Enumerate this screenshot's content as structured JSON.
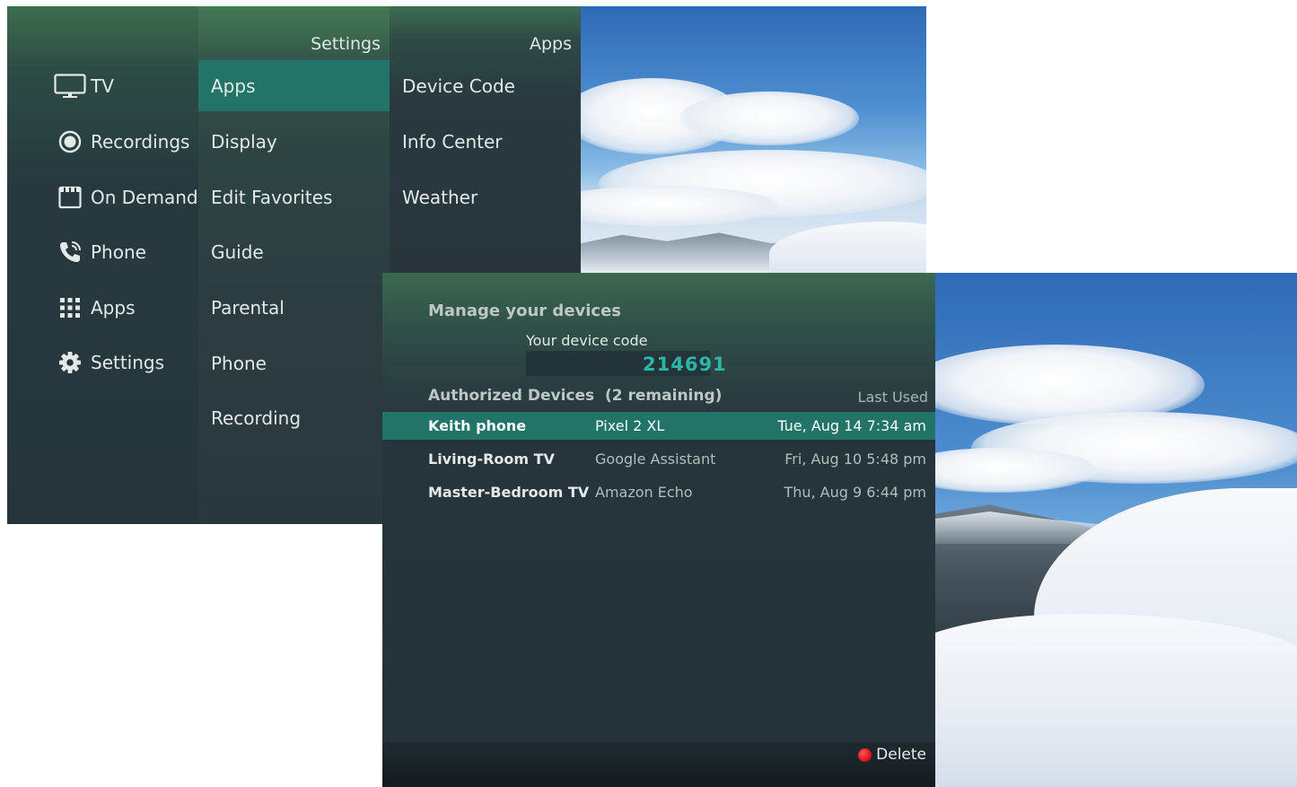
{
  "top_screen": {
    "main_nav": [
      {
        "label": "TV",
        "icon": "tv-icon"
      },
      {
        "label": "Recordings",
        "icon": "record-icon"
      },
      {
        "label": "On Demand",
        "icon": "film-icon"
      },
      {
        "label": "Phone",
        "icon": "phone-icon"
      },
      {
        "label": "Apps",
        "icon": "grid-icon"
      },
      {
        "label": "Settings",
        "icon": "gear-icon"
      }
    ],
    "settings_menu": {
      "header": "Settings",
      "items": [
        "Apps",
        "Display",
        "Edit Favorites",
        "Guide",
        "Parental",
        "Phone",
        "Recording"
      ],
      "selected": "Apps"
    },
    "apps_menu": {
      "header": "Apps",
      "items": [
        "Device Code",
        "Info Center",
        "Weather"
      ]
    }
  },
  "device_screen": {
    "title": "Manage your devices",
    "code_label": "Your device code",
    "device_code": "214691",
    "table_header": "Authorized Devices  (2 remaining)",
    "last_used_header": "Last Used",
    "devices": [
      {
        "name": "Keith phone",
        "model": "Pixel 2 XL",
        "last_used": "Tue, Aug 14 7:34 am",
        "selected": true
      },
      {
        "name": "Living-Room TV",
        "model": "Google Assistant",
        "last_used": "Fri, Aug 10 5:48 pm",
        "selected": false
      },
      {
        "name": "Master-Bedroom TV",
        "model": "Amazon Echo",
        "last_used": "Thu, Aug 9 6:44 pm",
        "selected": false
      }
    ],
    "delete_label": "Delete",
    "delete_color": "#e01f1f"
  },
  "colors": {
    "accent_teal": "#237468",
    "code_teal": "#2bb7a7"
  }
}
